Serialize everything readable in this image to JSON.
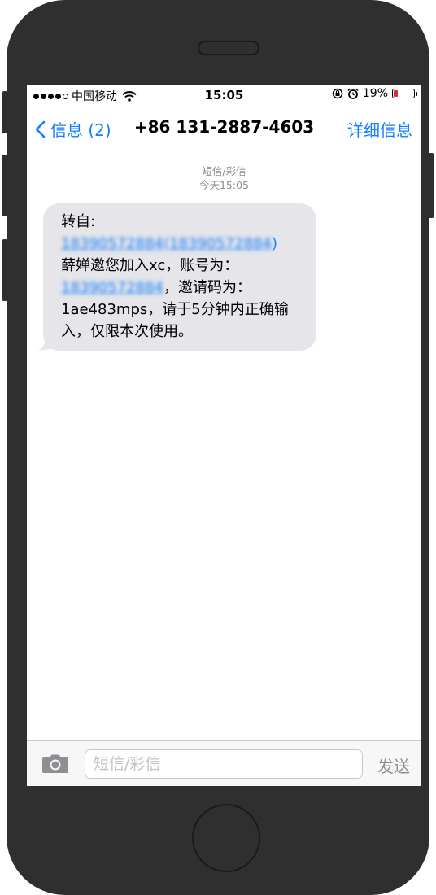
{
  "status_bar": {
    "carrier": "中国移动",
    "time": "15:05",
    "battery_percent": "19%",
    "battery_level": 0.19,
    "battery_color": "#e32b2b",
    "signal_bars_filled": 4,
    "signal_bars_total": 5
  },
  "nav": {
    "back_label": "信息 (2)",
    "title": "+86 131-2887-4603",
    "details_label": "详细信息"
  },
  "thread": {
    "message_type": "短信/彩信",
    "timestamp": "今天15:05"
  },
  "message": {
    "forward_prefix": "转自:",
    "link_number_1": "18390572884",
    "paren_open": "(",
    "link_number_2": "18390572884",
    "paren_close": ")",
    "invite_text": "薛婵邀您加入xc，账号为：",
    "link_number_3": "18390572884",
    "code_text": "，邀请码为：1ae483mps，请于5分钟内正确输入，仅限本次使用。"
  },
  "composer": {
    "placeholder": "短信/彩信",
    "value": "",
    "send_label": "发送"
  },
  "colors": {
    "accent": "#157efb",
    "bubble": "#e5e5ea",
    "phone_body": "#2f2f2f"
  }
}
